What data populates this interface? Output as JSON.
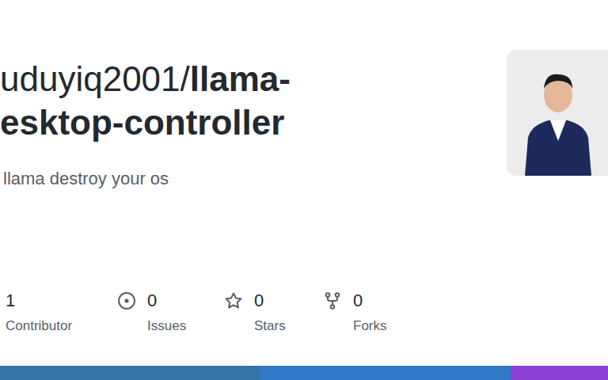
{
  "repo": {
    "owner": "uduyiq2001/",
    "name_line1": "llama-",
    "name_line2": "esktop-controller",
    "description": "llama destroy your os"
  },
  "stats": [
    {
      "kind": "contributors",
      "count": "1",
      "label": "Contributor"
    },
    {
      "kind": "issues",
      "count": "0",
      "label": "Issues"
    },
    {
      "kind": "stars",
      "count": "0",
      "label": "Stars"
    },
    {
      "kind": "forks",
      "count": "0",
      "label": "Forks"
    }
  ],
  "languages": [
    {
      "level": 0.427,
      "color": "#3572a5"
    },
    {
      "level": 0.413,
      "color": "#3178c6"
    },
    {
      "level": 0.16,
      "color": "#8a3fd1"
    }
  ]
}
